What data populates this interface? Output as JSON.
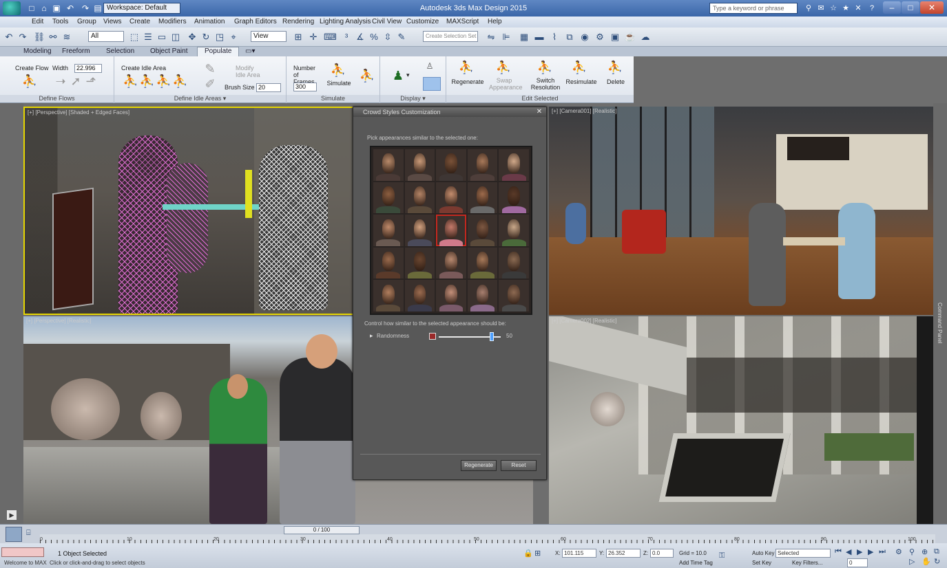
{
  "titlebar": {
    "workspace": "Workspace: Default",
    "title": "Autodesk 3ds Max Design 2015",
    "search_placeholder": "Type a keyword or phrase"
  },
  "menu": [
    "Edit",
    "Tools",
    "Group",
    "Views",
    "Create",
    "Modifiers",
    "Animation",
    "Graph Editors",
    "Rendering",
    "Lighting Analysis",
    "Civil View",
    "Customize",
    "MAXScript",
    "Help"
  ],
  "toolbar": {
    "selection_filter": "All",
    "reference_coord": "View",
    "named_selection": "Create Selection Set"
  },
  "ribbon_tabs": [
    "Modeling",
    "Freeform",
    "Selection",
    "Object Paint",
    "Populate"
  ],
  "ribbon_active": "Populate",
  "ribbon": {
    "define_flows": {
      "create_flow": "Create Flow",
      "width_label": "Width",
      "width_value": "22.996",
      "group_label": "Define Flows"
    },
    "define_idle_areas": {
      "create_idle_area": "Create Idle Area",
      "modify_idle_area": "Modify Idle Area",
      "brush_size_label": "Brush Size",
      "brush_size_value": "20",
      "group_label": "Define Idle Areas ▾"
    },
    "simulate": {
      "frames_label": "Number of Frames",
      "frames_value": "300",
      "simulate": "Simulate",
      "group_label": "Simulate"
    },
    "display": {
      "group_label": "Display ▾"
    },
    "edit_selected": {
      "regenerate": "Regenerate",
      "swap_appearance": "Swap Appearance",
      "switch_resolution": "Switch Resolution",
      "resimulate": "Resimulate",
      "delete": "Delete",
      "group_label": "Edit Selected"
    }
  },
  "viewports": [
    {
      "label": "[+] [Perspective] [Shaded + Edged Faces]"
    },
    {
      "label": "[+] [Camera001] [Realistic]"
    },
    {
      "label": "[+] [Perspective] [Realistic]"
    },
    {
      "label": "[+] [Camera002] [Realistic]"
    }
  ],
  "dialog": {
    "title": "Crowd Styles Customization",
    "instruction": "Pick appearances similar to the selected one:",
    "description": "Control how similar to the selected appearance should be:",
    "randomness_label": "Randomness",
    "randomness_max": "50",
    "randomness_value": 0.85,
    "regenerate": "Regenerate",
    "reset": "Reset",
    "selected_face_index": 12,
    "face_count": 25
  },
  "timeline": {
    "slider_text": "0 / 100",
    "ticks": [
      "0",
      "10",
      "20",
      "30",
      "40",
      "50",
      "60",
      "70",
      "80",
      "90",
      "100"
    ]
  },
  "status": {
    "selection": "1 Object Selected",
    "prompt": "Click or click-and-drag to select objects",
    "welcome": "Welcome to MAX",
    "x": "101.115",
    "y": "26.352",
    "z": "0.0",
    "grid": "Grid = 10.0",
    "auto_key": "Auto Key",
    "selected": "Selected",
    "set_key": "Set Key",
    "key_filters": "Key Filters...",
    "frame": "0",
    "add_time_tag": "Add Time Tag"
  },
  "colors": {
    "accent": "#3a66a8",
    "selected_viewport": "#e6d600",
    "selected_face": "#c5281f"
  }
}
